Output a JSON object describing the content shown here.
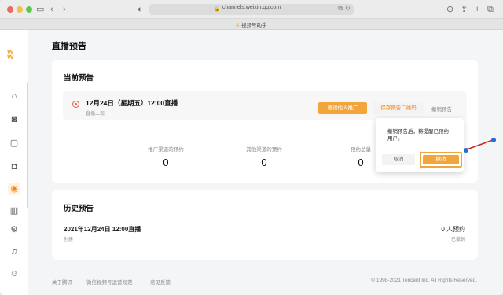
{
  "browser": {
    "url": "channels.weixin.qq.com",
    "tab_title": "视频号助手"
  },
  "page": {
    "title": "直播预告"
  },
  "current": {
    "section_title": "当前预告",
    "live_title": "12月24日（星期五）12:00直播",
    "status": "直播上现",
    "buttons": {
      "promote": "邀请他人推广",
      "save_qrcode": "保存预告二维码",
      "revoke": "撤销预告"
    },
    "stats": [
      {
        "label": "推广渠道的预约",
        "value": "0"
      },
      {
        "label": "其他渠道的预约",
        "value": "0"
      },
      {
        "label": "预约总量",
        "value": "0"
      }
    ]
  },
  "popover": {
    "message": "撤销预告后，将提醒已预约用户。",
    "cancel": "取消",
    "confirm": "撤销"
  },
  "history": {
    "section_title": "历史预告",
    "item_title": "2021年12月24日 12:00直播",
    "item_sub": "创建",
    "count": "0 人预约",
    "status": "已撤销"
  },
  "footer": {
    "links": [
      "关于腾讯",
      "微信视频号运营规范",
      "意见反馈"
    ],
    "copyright": "© 1998-2021 Tencent Inc. All Rights Reserved."
  },
  "colors": {
    "accent": "#f2a53a",
    "danger_radio": "#e8594a",
    "annotation_arrow": "#c62828",
    "annotation_dot": "#1e6fd9"
  },
  "icons": [
    "back-icon",
    "forward-icon",
    "sidebar-icon",
    "shield-icon",
    "lock-icon",
    "translate-icon",
    "reload-icon",
    "download-icon",
    "share-icon",
    "new-tab-icon",
    "tabs-icon",
    "home-icon",
    "camera-icon",
    "message-icon",
    "bag-icon",
    "live-icon",
    "chart-icon",
    "settings-icon",
    "bell-icon",
    "avatar-icon"
  ]
}
